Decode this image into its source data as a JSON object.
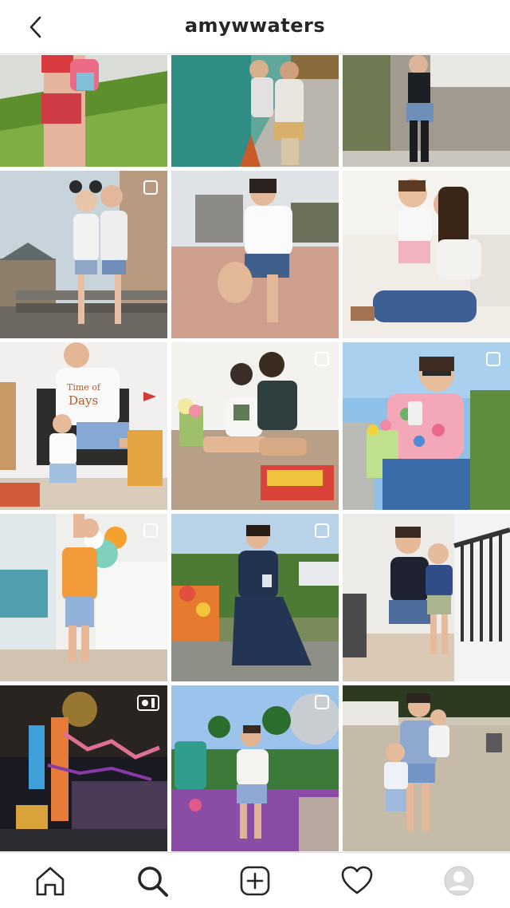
{
  "header": {
    "title": "amywwaters",
    "back_icon": "chevron-left-icon"
  },
  "grid": {
    "posts": [
      {
        "row": 1,
        "col": 1,
        "type": "photo",
        "badge": "none"
      },
      {
        "row": 1,
        "col": 2,
        "type": "photo",
        "badge": "none"
      },
      {
        "row": 1,
        "col": 3,
        "type": "photo",
        "badge": "none"
      },
      {
        "row": 2,
        "col": 1,
        "type": "carousel",
        "badge": "carousel-icon"
      },
      {
        "row": 2,
        "col": 2,
        "type": "photo",
        "badge": "none"
      },
      {
        "row": 2,
        "col": 3,
        "type": "photo",
        "badge": "none"
      },
      {
        "row": 3,
        "col": 1,
        "type": "photo",
        "badge": "none"
      },
      {
        "row": 3,
        "col": 2,
        "type": "carousel",
        "badge": "carousel-icon"
      },
      {
        "row": 3,
        "col": 3,
        "type": "carousel",
        "badge": "carousel-icon"
      },
      {
        "row": 4,
        "col": 1,
        "type": "carousel",
        "badge": "carousel-icon"
      },
      {
        "row": 4,
        "col": 2,
        "type": "carousel",
        "badge": "carousel-icon"
      },
      {
        "row": 4,
        "col": 3,
        "type": "photo",
        "badge": "none"
      },
      {
        "row": 5,
        "col": 1,
        "type": "video",
        "badge": "reels-icon"
      },
      {
        "row": 5,
        "col": 2,
        "type": "carousel",
        "badge": "carousel-icon"
      },
      {
        "row": 5,
        "col": 3,
        "type": "photo",
        "badge": "none"
      }
    ]
  },
  "bottom_nav": {
    "items": [
      "home-icon",
      "search-icon",
      "new-post-icon",
      "activity-heart-icon",
      "profile-avatar-icon"
    ],
    "active": "search-icon"
  },
  "colors": {
    "text": "#262626",
    "divider": "#dbdbdb",
    "background": "#ffffff"
  }
}
